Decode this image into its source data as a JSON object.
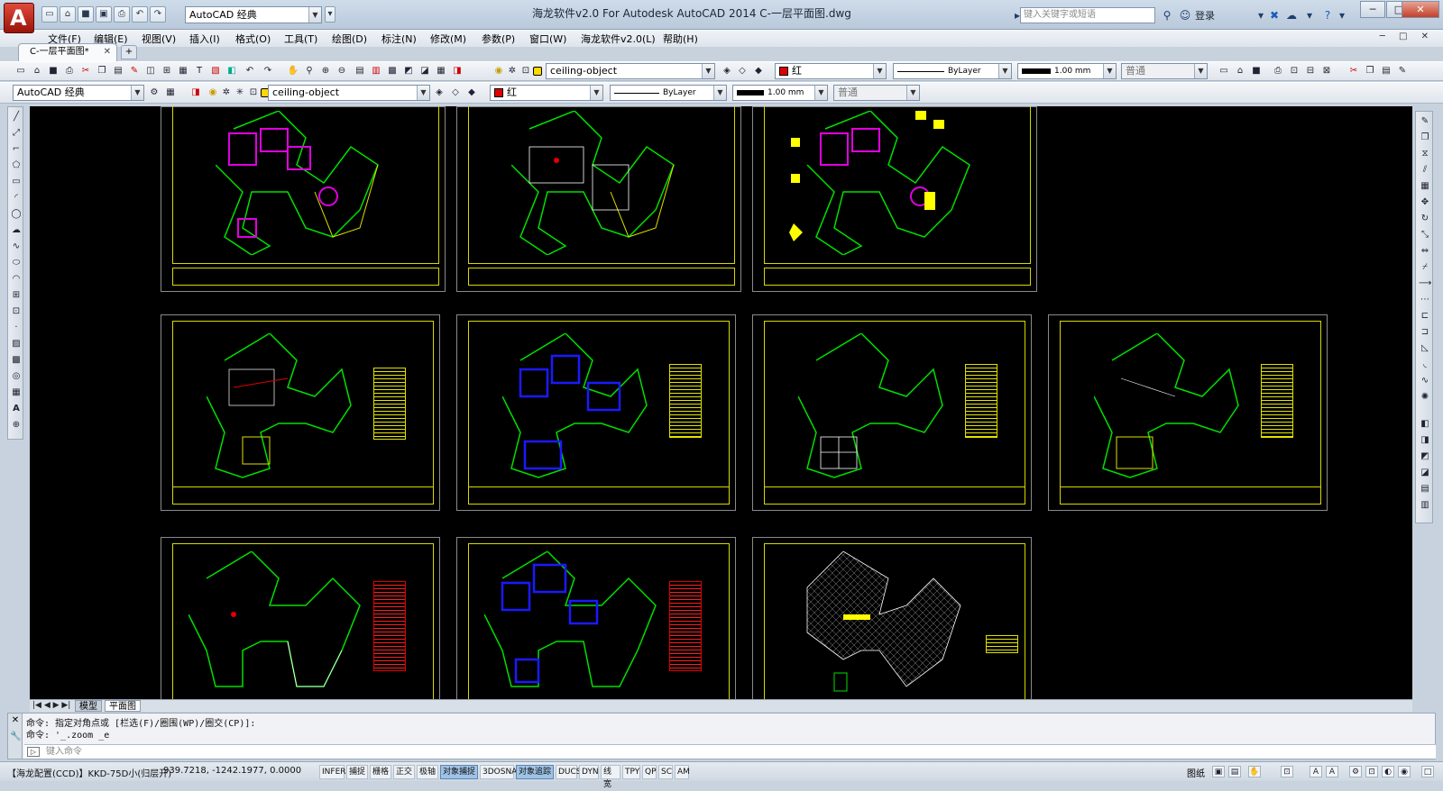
{
  "titlebar": {
    "app_logo": "A",
    "workspace": "AutoCAD 经典",
    "title": "海龙软件v2.0 For Autodesk AutoCAD 2014      C-一层平面图.dwg",
    "search_placeholder": "键入关键字或短语",
    "login": "登录",
    "min": "─",
    "max": "□",
    "close": "✕"
  },
  "menu": [
    "文件(F)",
    "编辑(E)",
    "视图(V)",
    "插入(I)",
    "格式(O)",
    "工具(T)",
    "绘图(D)",
    "标注(N)",
    "修改(M)",
    "参数(P)",
    "窗口(W)",
    "海龙软件v2.0(L)",
    "帮助(H)"
  ],
  "doc_controls": "─ □ ✕",
  "file_tab": {
    "label": "C-一层平面图*",
    "close": "✕"
  },
  "toolbar1": {
    "layer": "ceiling-object",
    "color": "红",
    "linetype": "ByLayer",
    "lineweight": "1.00 mm",
    "plotstyle": "普通"
  },
  "toolbar2": {
    "workspace": "AutoCAD 经典",
    "layer": "ceiling-object",
    "color": "红",
    "linetype": "ByLayer",
    "lineweight": "1.00 mm",
    "plotstyle": "普通"
  },
  "layout_tabs": {
    "model": "模型",
    "layout": "平面图",
    "nav": "|◀ ◀ ▶ ▶|"
  },
  "command": {
    "line1": "命令: 指定对角点或 [栏选(F)/圈围(WP)/圈交(CP)]:",
    "line2": "命令: '_.zoom _e",
    "placeholder": "键入命令",
    "prompt_icon": "▷"
  },
  "status": {
    "left": "【海龙配置(CCD)】KKD-75D小(归层开)",
    "coords": "939.7218,  -1242.1977, 0.0000",
    "buttons": [
      {
        "label": "INFER",
        "on": false
      },
      {
        "label": "捕捉",
        "on": false
      },
      {
        "label": "栅格",
        "on": false
      },
      {
        "label": "正交",
        "on": false
      },
      {
        "label": "极轴",
        "on": false
      },
      {
        "label": "对象捕捉",
        "on": true
      },
      {
        "label": "3DOSNAP",
        "on": false
      },
      {
        "label": "对象追踪",
        "on": true
      },
      {
        "label": "DUCS",
        "on": false
      },
      {
        "label": "DYN",
        "on": false
      },
      {
        "label": "线宽",
        "on": false
      },
      {
        "label": "TPY",
        "on": false
      },
      {
        "label": "QP",
        "on": false
      },
      {
        "label": "SC",
        "on": false
      },
      {
        "label": "AM",
        "on": false
      }
    ],
    "right_label": "图纸"
  },
  "colors": {
    "accent": "#3d7cc9",
    "drawing_bg": "#000000",
    "frame": "#d8d800",
    "status_on": "#9fc3e7"
  }
}
